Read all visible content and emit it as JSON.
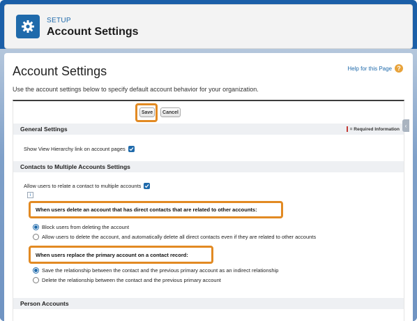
{
  "header": {
    "setup_label": "SETUP",
    "title": "Account Settings",
    "icon": "gear-icon"
  },
  "page": {
    "title": "Account Settings",
    "help_link": "Help for this Page",
    "help_icon": "question-icon",
    "intro": "Use the account settings below to specify default account behavior for your organization."
  },
  "toolbar": {
    "save_label": "Save",
    "cancel_label": "Cancel"
  },
  "sections": {
    "general": {
      "title": "General Settings",
      "required_info": "= Required Information",
      "hierarchy_label": "Show View Hierarchy link on account pages",
      "hierarchy_checked": true
    },
    "contacts": {
      "title": "Contacts to Multiple Accounts Settings",
      "allow_label": "Allow users to relate a contact to multiple accounts",
      "allow_checked": true,
      "info_glyph": "i",
      "delete_question": "When users delete an account that has direct contacts that are related to other accounts:",
      "delete_options": [
        {
          "label": "Block users from deleting the account",
          "selected": true
        },
        {
          "label": "Allow users to delete the account, and automatically delete all direct contacts even if they are related to other accounts",
          "selected": false
        }
      ],
      "replace_question": "When users replace the primary account on a contact record:",
      "replace_options": [
        {
          "label": "Save the relationship between the contact and the previous primary account as an indirect relationship",
          "selected": true
        },
        {
          "label": "Delete the relationship between the contact and the previous primary account",
          "selected": false
        }
      ]
    },
    "person": {
      "title": "Person Accounts"
    }
  },
  "colors": {
    "brand": "#1f6aab",
    "highlight": "#e28a23",
    "required": "#c23934"
  }
}
